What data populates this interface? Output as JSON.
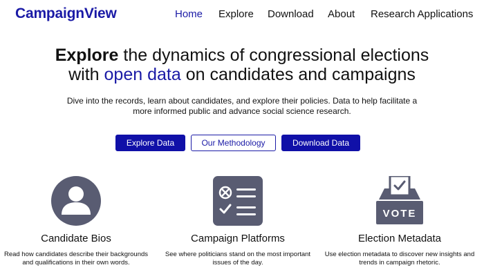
{
  "brand": {
    "name": "CampaignView",
    "color": "#1a1aa6"
  },
  "nav": {
    "home": "Home",
    "explore": "Explore",
    "download": "Download",
    "about": "About",
    "research": "Research Applications",
    "active": "Home"
  },
  "hero": {
    "title_bold": "Explore",
    "title_rest": " the dynamics of congressional elections",
    "title_line2_pre": "with ",
    "title_line2_accent": "open data",
    "title_line2_post": " on candidates and campaigns",
    "subtitle": "Dive into the records, learn about candidates, and explore their policies. Data to help facilitate a more informed public and advance social science research."
  },
  "buttons": {
    "explore_data": "Explore Data",
    "methodology": "Our Methodology",
    "download_data": "Download Data"
  },
  "features": [
    {
      "icon": "person-avatar-icon",
      "title": "Candidate Bios",
      "description": "Read how candidates describe their backgrounds and qualifications in their own words."
    },
    {
      "icon": "checklist-icon",
      "title": "Campaign Platforms",
      "description": "See where politicians stand on the most important issues of the day."
    },
    {
      "icon": "ballot-box-icon",
      "title": "Election Metadata",
      "description": "Use election metadata to discover new insights and trends in campaign rhetoric.",
      "icon_text": "VOTE"
    }
  ],
  "colors": {
    "accent": "#1a1aa6",
    "button_fill": "#1010a8",
    "icon_fill": "#595c72"
  }
}
